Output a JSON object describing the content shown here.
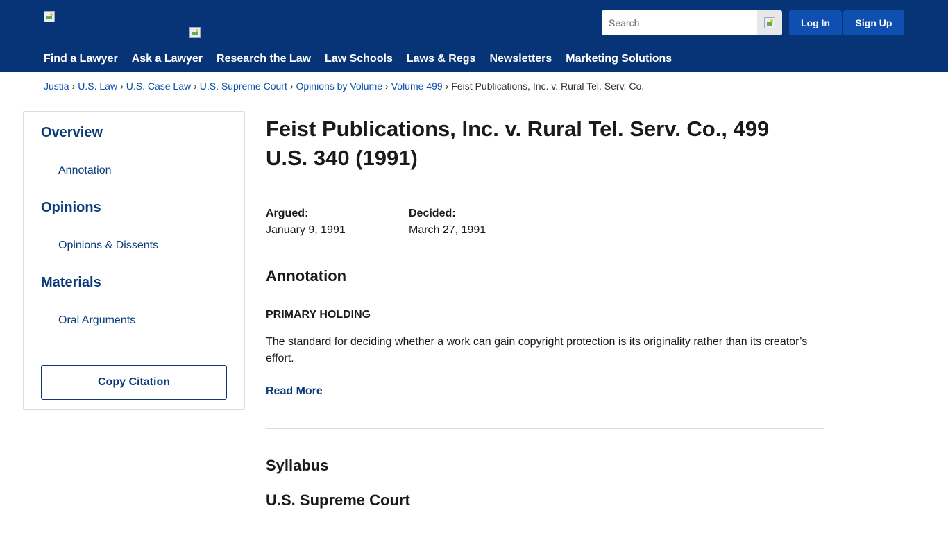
{
  "header": {
    "search_placeholder": "Search",
    "login_label": "Log In",
    "signup_label": "Sign Up",
    "icons": {
      "logo": "broken-image-icon",
      "search": "broken-image-icon"
    }
  },
  "nav": {
    "items": [
      "Find a Lawyer",
      "Ask a Lawyer",
      "Research the Law",
      "Law Schools",
      "Laws & Regs",
      "Newsletters",
      "Marketing Solutions"
    ]
  },
  "breadcrumb": {
    "links": [
      "Justia",
      "U.S. Law",
      "U.S. Case Law",
      "U.S. Supreme Court",
      "Opinions by Volume",
      "Volume 499"
    ],
    "separator": "›",
    "current": "Feist Publications, Inc. v. Rural Tel. Serv. Co."
  },
  "sidebar": {
    "overview": "Overview",
    "annotation": "Annotation",
    "opinions": "Opinions",
    "opinions_dissents": "Opinions & Dissents",
    "materials": "Materials",
    "oral_arguments": "Oral Arguments",
    "copy_citation": "Copy Citation"
  },
  "main": {
    "title": "Feist Publications, Inc. v. Rural Tel. Serv. Co., 499 U.S. 340 (1991)",
    "argued_label": "Argued:",
    "argued_date": "January 9, 1991",
    "decided_label": "Decided:",
    "decided_date": "March 27, 1991",
    "annotation_heading": "Annotation",
    "primary_holding_label": "PRIMARY HOLDING",
    "primary_holding_text": "The standard for deciding whether a work can gain copyright protection is its originality rather than its creator’s effort.",
    "read_more": "Read More",
    "syllabus_heading": "Syllabus",
    "court_heading": "U.S. Supreme Court"
  },
  "colors": {
    "header_bg": "#073477",
    "button_bg": "#0f4fb0",
    "link": "#0b4fa8",
    "sidebar_link": "#0a3a7a"
  }
}
